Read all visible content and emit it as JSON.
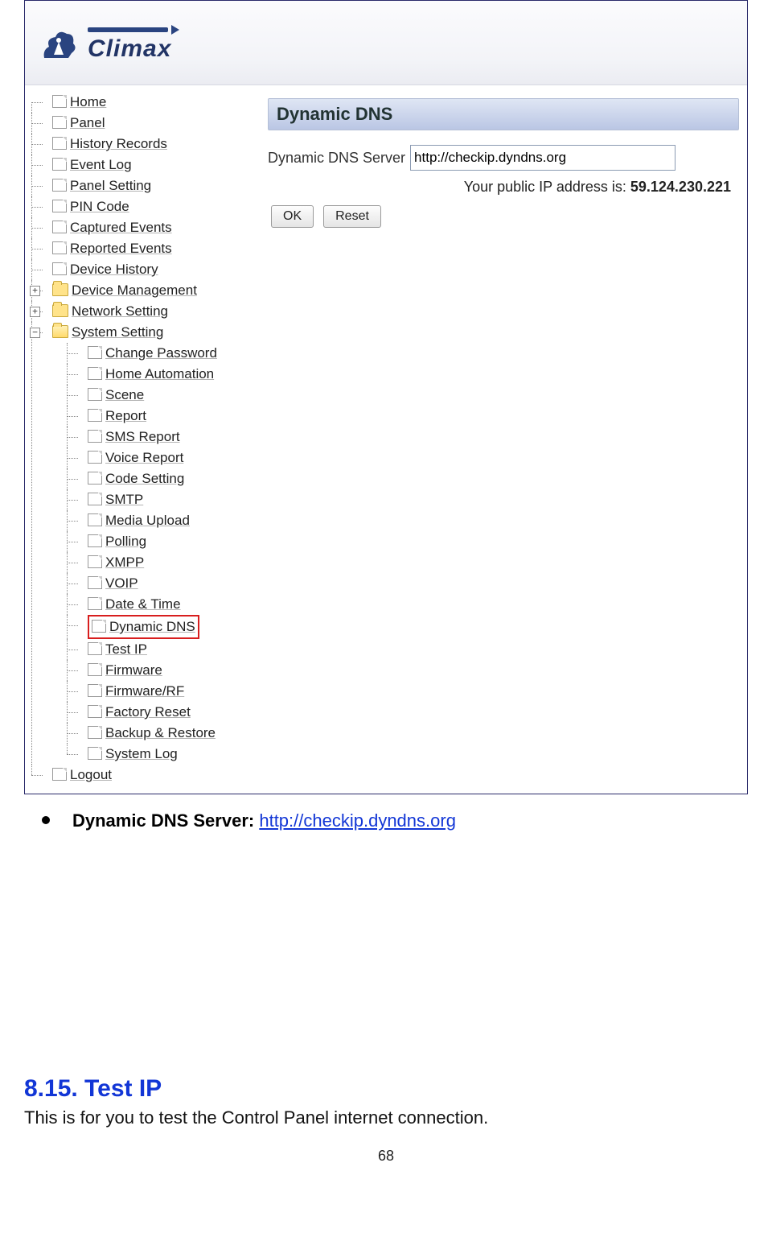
{
  "logo": {
    "text": "Climax"
  },
  "nav": {
    "items": [
      {
        "label": "Home",
        "type": "file"
      },
      {
        "label": "Panel",
        "type": "file"
      },
      {
        "label": "History Records",
        "type": "file"
      },
      {
        "label": "Event Log",
        "type": "file"
      },
      {
        "label": "Panel Setting",
        "type": "file"
      },
      {
        "label": "PIN Code",
        "type": "file"
      },
      {
        "label": "Captured Events",
        "type": "file"
      },
      {
        "label": "Reported Events",
        "type": "file"
      },
      {
        "label": "Device History",
        "type": "file"
      },
      {
        "label": "Device Management",
        "type": "folder",
        "expander": "+"
      },
      {
        "label": "Network Setting",
        "type": "folder",
        "expander": "+"
      },
      {
        "label": "System Setting",
        "type": "folder-open",
        "expander": "−",
        "children": [
          {
            "label": "Change Password"
          },
          {
            "label": "Home Automation"
          },
          {
            "label": "Scene"
          },
          {
            "label": "Report"
          },
          {
            "label": "SMS Report"
          },
          {
            "label": "Voice Report"
          },
          {
            "label": "Code Setting"
          },
          {
            "label": "SMTP"
          },
          {
            "label": "Media Upload"
          },
          {
            "label": "Polling"
          },
          {
            "label": "XMPP"
          },
          {
            "label": "VOIP"
          },
          {
            "label": "Date & Time"
          },
          {
            "label": "Dynamic DNS",
            "selected": true
          },
          {
            "label": "Test IP"
          },
          {
            "label": "Firmware"
          },
          {
            "label": "Firmware/RF"
          },
          {
            "label": "Factory Reset"
          },
          {
            "label": "Backup & Restore"
          },
          {
            "label": "System Log"
          }
        ]
      },
      {
        "label": "Logout",
        "type": "file"
      }
    ]
  },
  "panel": {
    "title": "Dynamic DNS",
    "server_label": "Dynamic DNS Server",
    "server_value": "http://checkip.dyndns.org",
    "ip_label": "Your public IP address is:",
    "ip_value": "59.124.230.221",
    "ok": "OK",
    "reset": "Reset"
  },
  "doc": {
    "bullet_label": "Dynamic DNS Server:",
    "bullet_link_text": "http://checkip.dyndns.org",
    "section_title": "8.15. Test IP",
    "section_body": "This is for you to test the Control Panel internet connection.",
    "page_number": "68"
  }
}
